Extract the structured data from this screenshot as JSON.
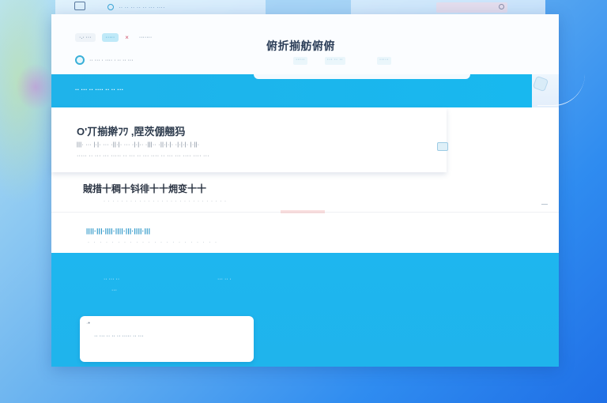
{
  "topbar": {
    "tab_label": "·· ·· ·· ·· ·· ··· ····"
  },
  "header": {
    "crumbs": [
      "·.· ···",
      "·····",
      "·······"
    ],
    "close_symbol": "×",
    "title": "俯折揃舫俯俯",
    "user_text": "·· ··· · ···· · ·· ·· ···",
    "tabs": [
      "·····",
      "··· ·· ··",
      "·····"
    ]
  },
  "banner": {
    "text": "·· ··· ·· ···· ·· ·· ···"
  },
  "card1": {
    "title": "O'丌揃擀ﾌﾜ ,陧茨倗翹犸",
    "line1": "|||· ··· |·|· ··· ·||·|· ··· ·|·|·· ·|||·· ·||·|·|· ·|·|·|· |·||·",
    "line2": "····· ·· ··· ··· ····· ·· ··· ·· ··· ···· ·· ··· ··· ···· ···· ···"
  },
  "section2": {
    "title": "賊措十稠十钭徘十十㶲变十十",
    "sub": "· · · · · · · · · · · · · · · · · · · · · · · · · · · ·"
  },
  "links": {
    "text": "||||·|||·||||·||||·|||·||||·|||",
    "sub": "· · · · · · · · · · · · · · · · · · · · · ·"
  },
  "panel": {
    "label_left": "·· ··· ··",
    "label_right": "··· ·· ·",
    "label_small": "···",
    "box_text": "·· ··· ·· ·· ·· ····· ·· ···",
    "box_mark": "·•"
  },
  "colors": {
    "accent": "#1fb3ea",
    "link": "#1c8fc4",
    "background": "#2f8cf0"
  }
}
